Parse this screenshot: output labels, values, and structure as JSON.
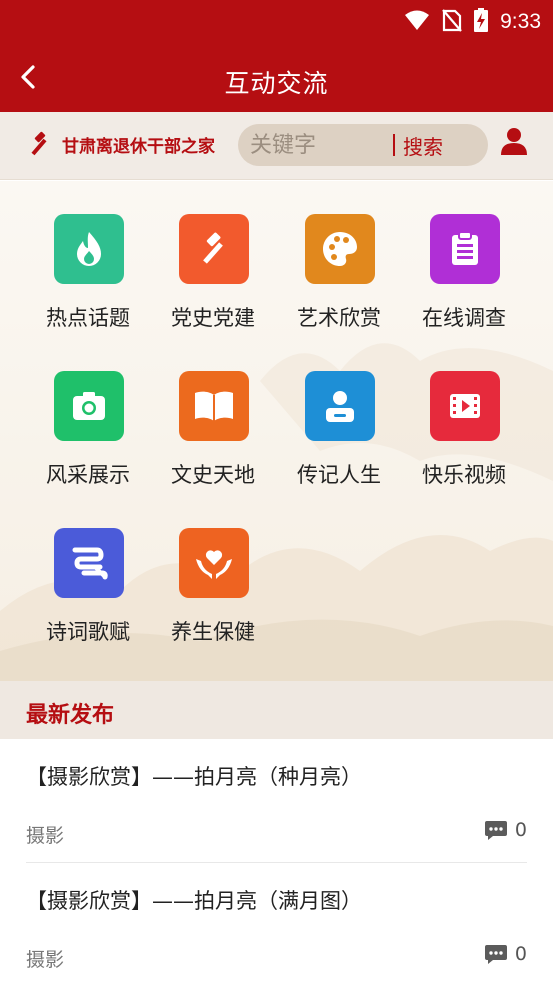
{
  "status": {
    "time": "9:33"
  },
  "appbar": {
    "title": "互动交流"
  },
  "header": {
    "logo_text": "甘肃离退休干部之家",
    "search_placeholder": "关键字",
    "search_button": "搜索"
  },
  "grid": [
    {
      "label": "热点话题",
      "icon": "flame-icon",
      "color": "#2fbf8f"
    },
    {
      "label": "党史党建",
      "icon": "party-emblem-icon",
      "color": "#f25a2d"
    },
    {
      "label": "艺术欣赏",
      "icon": "palette-icon",
      "color": "#e1881d"
    },
    {
      "label": "在线调查",
      "icon": "clipboard-icon",
      "color": "#b02fd6"
    },
    {
      "label": "风采展示",
      "icon": "camera-icon",
      "color": "#1fc06a"
    },
    {
      "label": "文史天地",
      "icon": "open-book-icon",
      "color": "#ec6a1e"
    },
    {
      "label": "传记人生",
      "icon": "person-icon",
      "color": "#1e8fd6"
    },
    {
      "label": "快乐视频",
      "icon": "film-icon",
      "color": "#e62a3c"
    },
    {
      "label": "诗词歌赋",
      "icon": "poetry-icon",
      "color": "#4b5bd9"
    },
    {
      "label": "养生保健",
      "icon": "heart-hands-icon",
      "color": "#ee6321"
    }
  ],
  "section": {
    "title": "最新发布"
  },
  "posts": [
    {
      "title": "【摄影欣赏】——拍月亮（种月亮）",
      "category": "摄影",
      "comments": "0"
    },
    {
      "title": "【摄影欣赏】——拍月亮（满月图）",
      "category": "摄影",
      "comments": "0"
    }
  ]
}
